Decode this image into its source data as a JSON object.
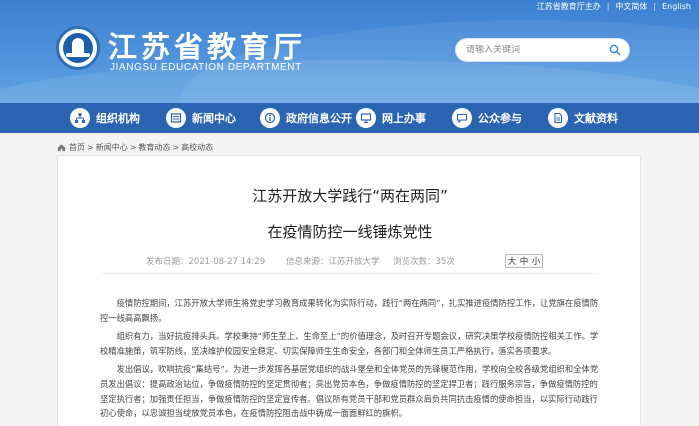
{
  "topbar": {
    "sponsor": "江苏省教育厅主办",
    "chinese": "中文简体",
    "english": "English",
    "separator": "|"
  },
  "header": {
    "title": "江苏省教育厅",
    "subtitle": "JIANGSU EDUCATION DEPARTMENT",
    "search_placeholder": "请输入关键词"
  },
  "nav": {
    "items": [
      {
        "label": "组织机构",
        "icon": "org-chart-icon"
      },
      {
        "label": "新闻中心",
        "icon": "news-icon"
      },
      {
        "label": "政府信息公开",
        "icon": "info-open-icon"
      },
      {
        "label": "网上办事",
        "icon": "monitor-icon"
      },
      {
        "label": "公众参与",
        "icon": "chat-icon"
      },
      {
        "label": "文献资料",
        "icon": "document-icon"
      }
    ]
  },
  "breadcrumb": {
    "items": [
      "首页",
      "新闻中心",
      "教育动态",
      "高校动态"
    ],
    "separator": ">"
  },
  "article": {
    "title_line1": "江苏开放大学践行“两在两同”",
    "title_line2": "在疫情防控一线锤炼党性",
    "publish_time": "发布日期：2021-08-27 14:29",
    "source": "信息来源：江苏开放大学",
    "views": "浏览次数：35次",
    "font_size": {
      "big": "大",
      "mid": "中",
      "small": "小"
    },
    "paragraphs": [
      "疫情防控期间，江苏开放大学师生将党史学习教育成果转化为实际行动，践行“两在两同”，扎实推进疫情防控工作，让党旗在疫情防控一线高高飘扬。",
      "组织有力，当好抗疫排头兵。学校秉持“师生至上、生命至上”的价值理念，及时召开专题会议，研究决策学校疫情防控相关工作。学校精准施策，筑牢防线，坚决维护校园安全稳定、切实保障师生生命安全，各部门和全体师生员工严格执行，落实各项要求。",
      "发出倡议，吹响抗疫“集结号”。为进一步发挥各基层党组织的战斗堡垒和全体党员的先锋模范作用，学校向全校各级党组织和全体党员发出倡议：提高政治站位，争做疫情防控的坚定贯彻者；亮出党员本色，争做疫情防控的坚定捍卫者；践行服务宗旨，争做疫情防控的坚定执行者；加强责任担当，争做疫情防控的坚定宣传者。倡议所有党员干部和党员群众肩负共同抗击疫情的使命担当，以实际行动践行初心使命，以忠诚担当绽放党员本色，在疫情防控阻击战中铸成一面面鲜红的旗帜。"
    ]
  },
  "colors": {
    "header_blue": "#4f93dc",
    "nav_blue": "#2a64b3",
    "page_bg": "#f3f3f3"
  }
}
